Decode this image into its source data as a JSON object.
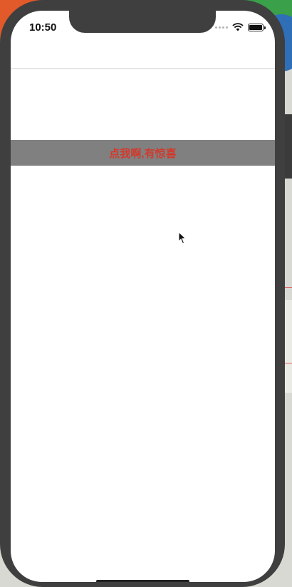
{
  "status_bar": {
    "time": "10:50",
    "icons": [
      "signal-icon",
      "wifi-icon",
      "battery-icon"
    ]
  },
  "content": {
    "button_label": "点我啊,有惊喜"
  },
  "colors": {
    "button_background": "#808080",
    "button_text": "#d23a2c",
    "device_frame": "#3f3f3f"
  }
}
